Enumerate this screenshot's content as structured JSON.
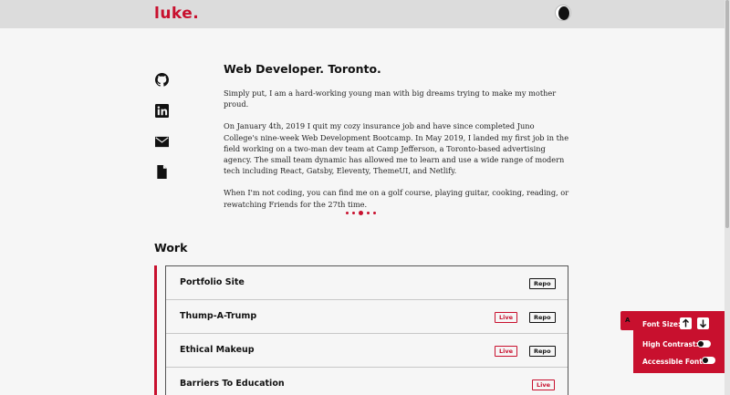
{
  "header": {
    "logo": "luke.",
    "theme_toggle_icon": "moon-icon"
  },
  "social": [
    {
      "name": "github-icon"
    },
    {
      "name": "linkedin-icon"
    },
    {
      "name": "mail-icon"
    },
    {
      "name": "resume-document-icon"
    }
  ],
  "intro": {
    "heading": "Web Developer. Toronto.",
    "p1": "Simply put, I am a hard-working young man with big dreams trying to make my mother proud.",
    "p2": "On January 4th, 2019 I quit my cozy insurance job and have since completed Juno College's nine-week Web Development Bootcamp. In May 2019, I landed my first job in the field working on a two-man dev team at Camp Jefferson, a Toronto-based advertising agency. The small team dynamic has allowed me to learn and use a wide range of modern tech including React, Gatsby, Eleventy, ThemeUI, and Netlify.",
    "p3": "When I'm not coding, you can find me on a golf course, playing guitar, cooking, reading, or rewatching Friends for the 27th time."
  },
  "carousel": {
    "count": 5,
    "active_index": 2
  },
  "work": {
    "title": "Work",
    "items": [
      {
        "name": "Portfolio Site",
        "live": "",
        "repo": "Repo"
      },
      {
        "name": "Thump-A-Trump",
        "live": "Live",
        "repo": "Repo"
      },
      {
        "name": "Ethical Makeup",
        "live": "Live",
        "repo": "Repo"
      },
      {
        "name": "Barriers To Education",
        "live": "Live",
        "repo": ""
      }
    ]
  },
  "accessibility": {
    "tab_label": "A",
    "font_size_label": "Font Size:",
    "high_contrast_label": "High Contrast:",
    "accessible_font_label": "Accessible Font:",
    "high_contrast_on": false,
    "accessible_font_on": false
  },
  "colors": {
    "accent": "#c8102e",
    "background": "#f6f6f6",
    "header": "#dcdcdc"
  }
}
